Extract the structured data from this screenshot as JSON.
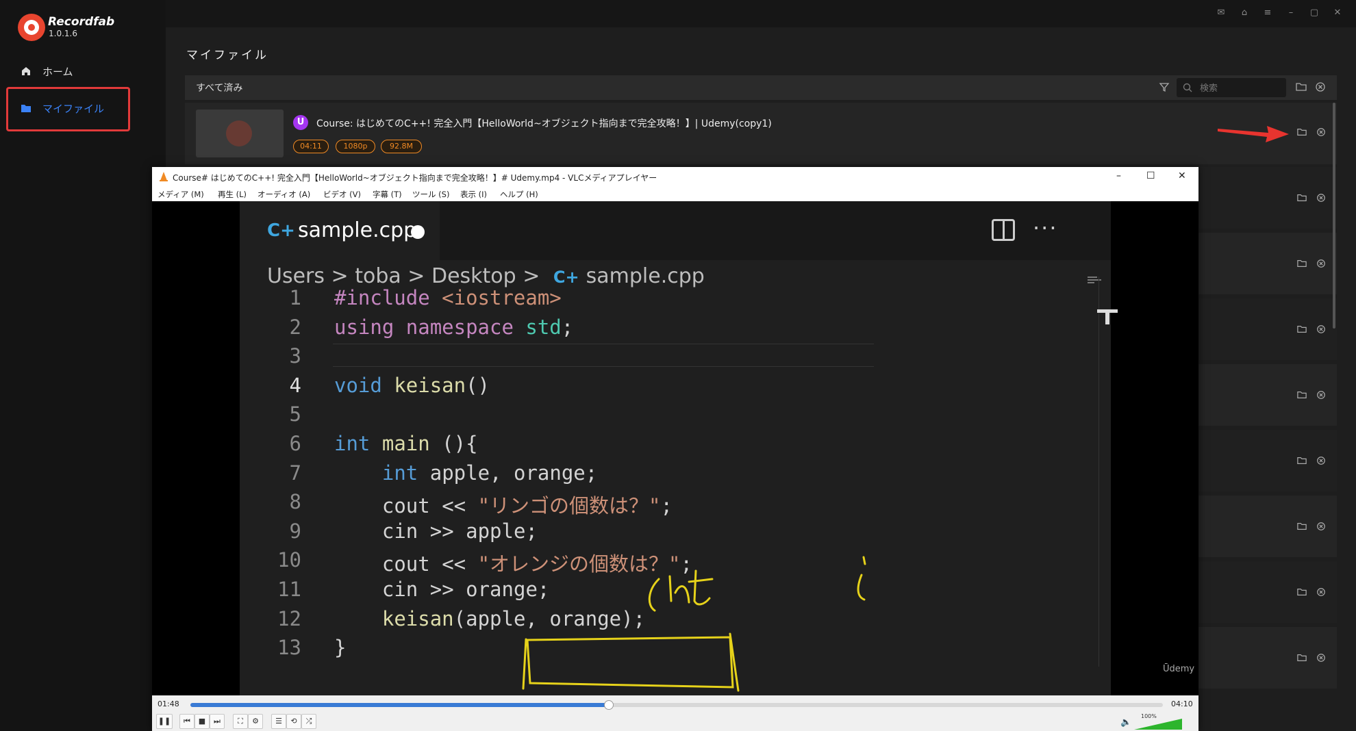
{
  "app": {
    "name": "Recordfab",
    "version": "1.0.1.6"
  },
  "sidebar": {
    "items": [
      {
        "label": "ホーム",
        "icon": "home-icon"
      },
      {
        "label": "マイファイル",
        "icon": "folder-icon",
        "active": true
      }
    ]
  },
  "main": {
    "page_title": "マイファイル",
    "filter_label": "すべて済み",
    "search_placeholder": "検索",
    "rows": [
      {
        "title": "Course: はじめてのC++! 完全入門【HelloWorld~オブジェクト指向まで完全攻略！】| Udemy(copy1)",
        "tags": [
          "04:11",
          "1080p",
          "92.8M"
        ]
      }
    ]
  },
  "vlc": {
    "title": "Course# はじめてのC++! 完全入門【HelloWorld~オブジェクト指向まで完全攻略！】# Udemy.mp4 - VLCメディアプレイヤー",
    "menu": [
      "メディア (M)",
      "再生 (L)",
      "オーディオ (A)",
      "ビデオ (V)",
      "字幕 (T)",
      "ツール (S)",
      "表示 (I)",
      "ヘルプ (H)"
    ],
    "time_current": "01:48",
    "time_total": "04:10",
    "progress": 0.43,
    "volume": "100%"
  },
  "editor": {
    "tab_name": "sample.cpp",
    "breadcrumb": "Users > toba > Desktop >",
    "breadcrumb_file": "sample.cpp",
    "watermark": "Ūdemy",
    "lines": [
      {
        "n": "1",
        "code": "#include <iostream>"
      },
      {
        "n": "2",
        "code": "using namespace std;"
      },
      {
        "n": "3",
        "code": ""
      },
      {
        "n": "4",
        "code": "void keisan()"
      },
      {
        "n": "5",
        "code": ""
      },
      {
        "n": "6",
        "code": "int main (){"
      },
      {
        "n": "7",
        "code": "    int apple, orange;"
      },
      {
        "n": "8",
        "code": "    cout << \"リンゴの個数は？\";"
      },
      {
        "n": "9",
        "code": "    cin >> apple;"
      },
      {
        "n": "10",
        "code": "    cout << \"オレンジの個数は？\";"
      },
      {
        "n": "11",
        "code": "    cin >> orange;"
      },
      {
        "n": "12",
        "code": "    keisan(apple, orange);"
      },
      {
        "n": "13",
        "code": "}"
      }
    ],
    "handwriting": "(int"
  }
}
